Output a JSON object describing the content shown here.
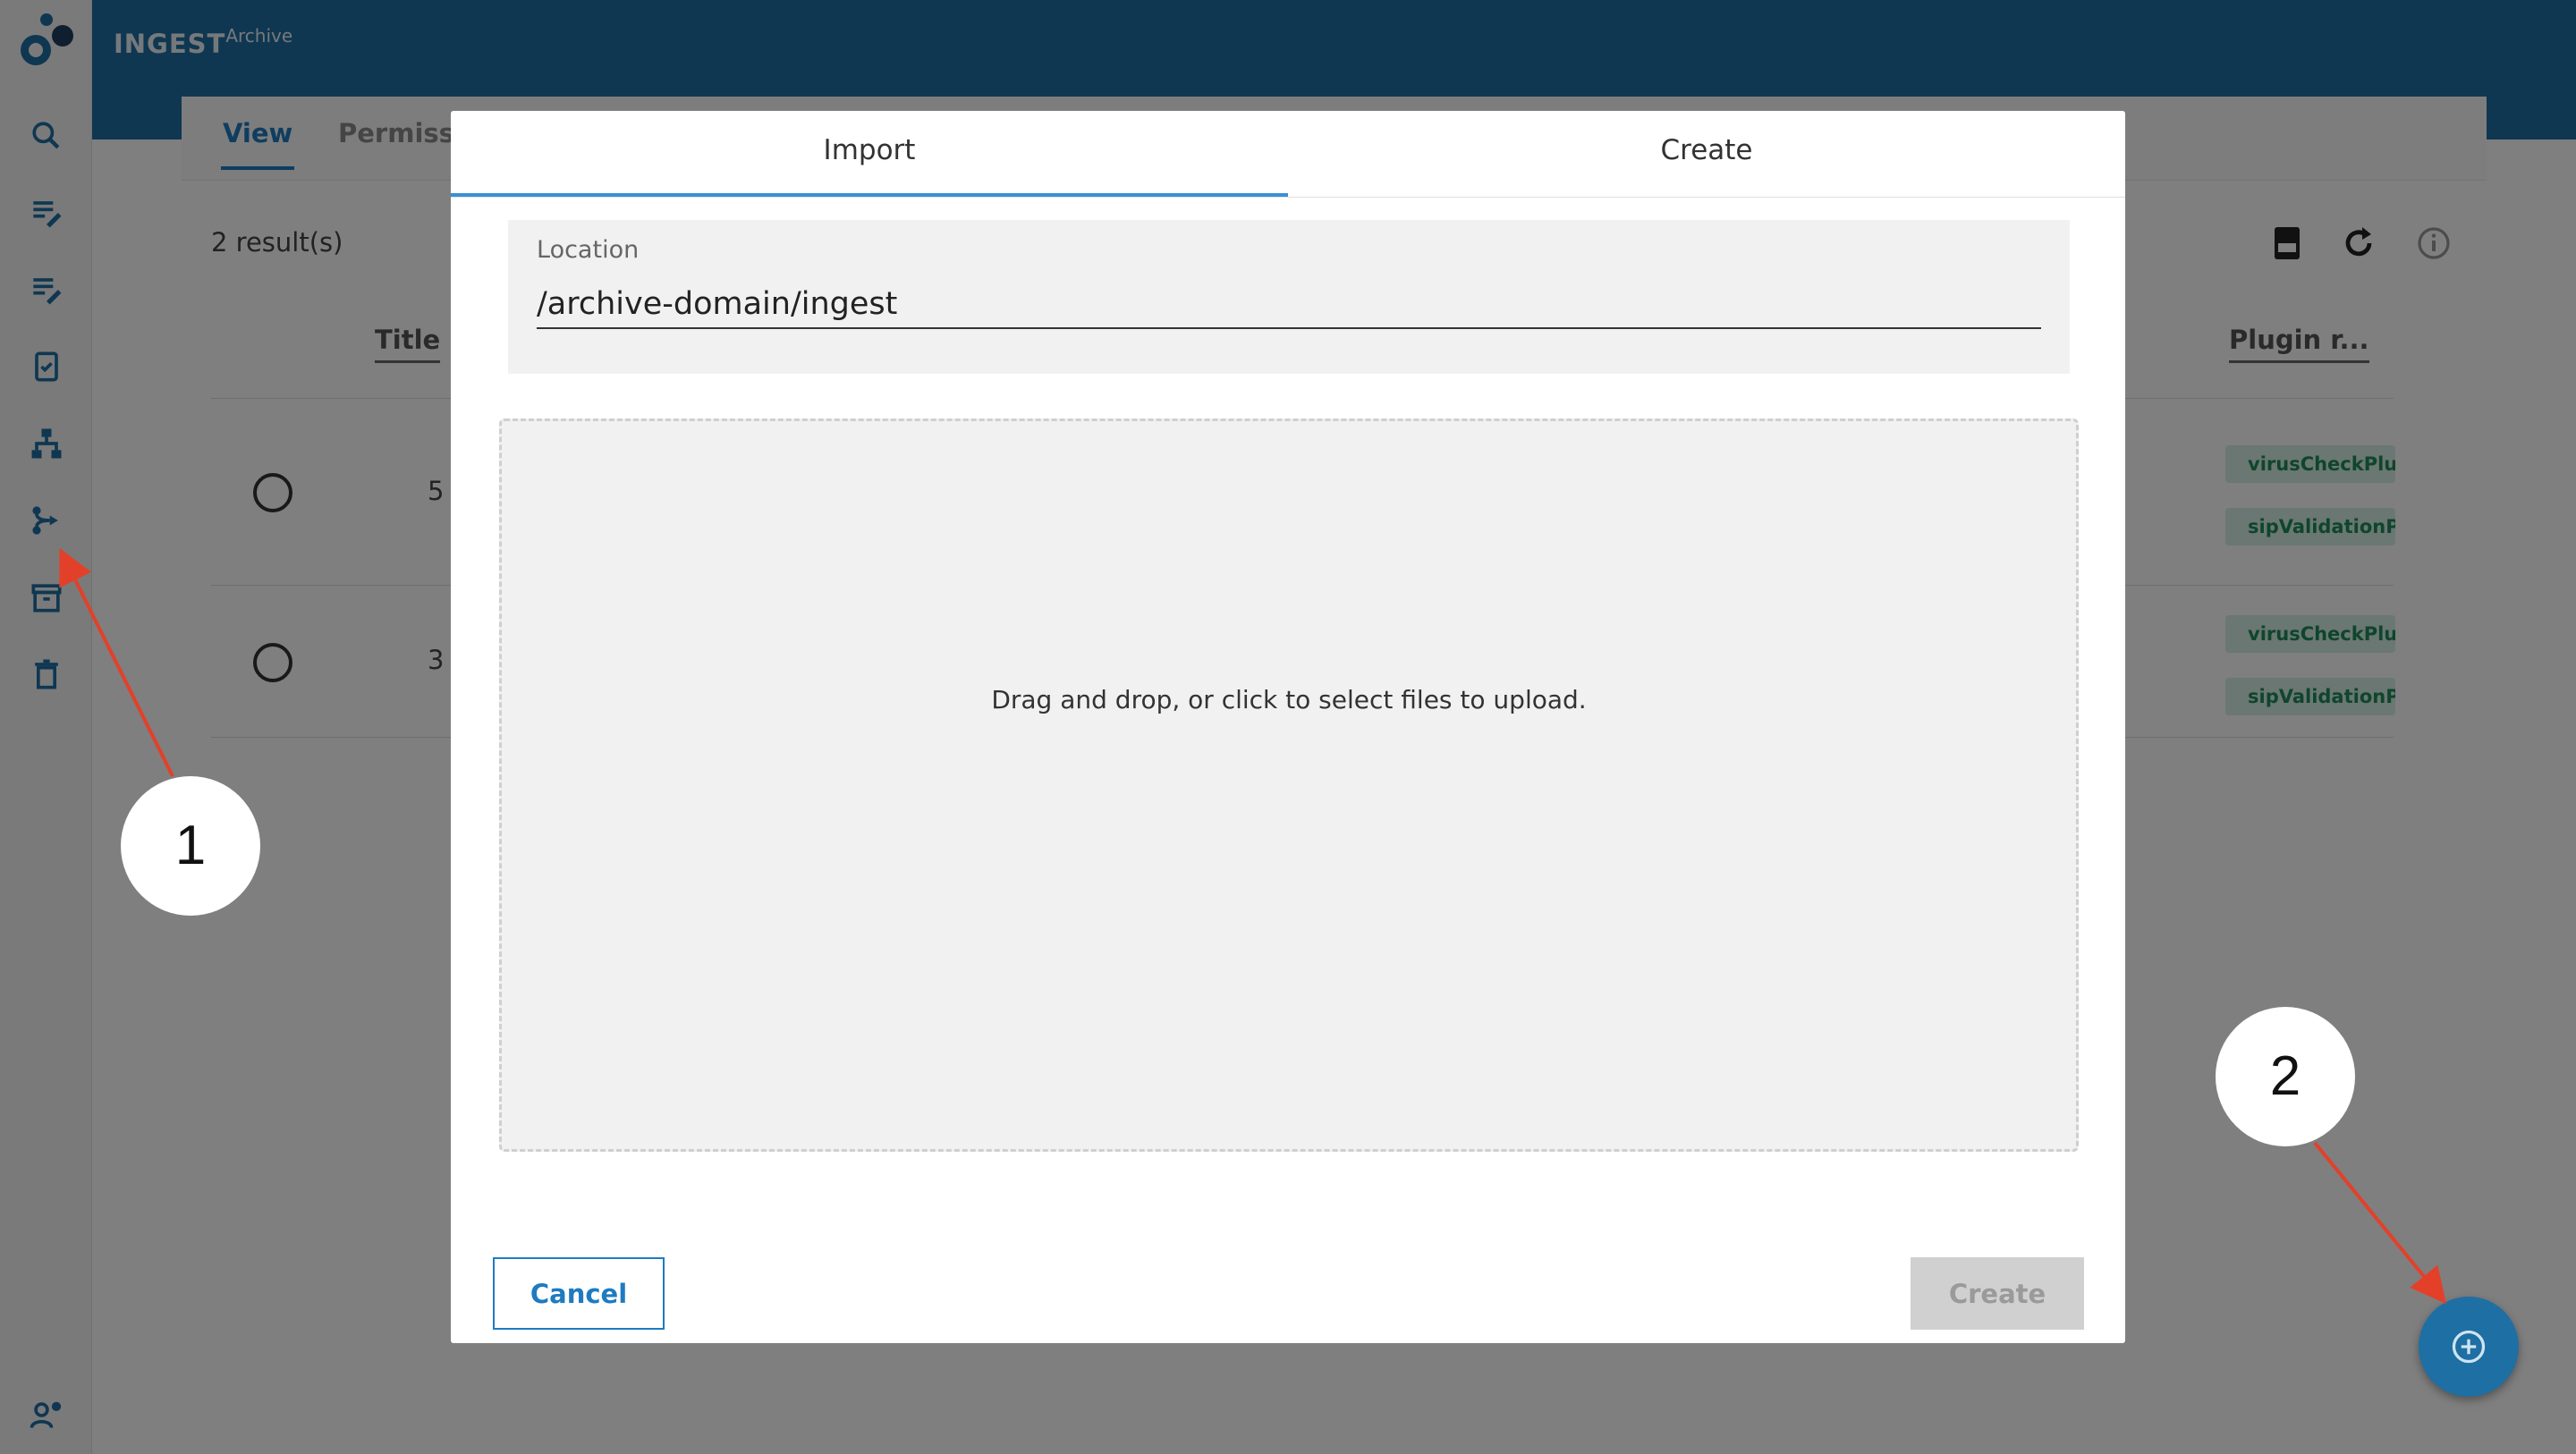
{
  "app": {
    "brand_main": "INGEST",
    "brand_sub": "Archive",
    "accent": "#1e6fa3"
  },
  "sidebar": {
    "icons": [
      "logo-icon",
      "search-icon",
      "edit-list-icon",
      "edit-list-icon",
      "checklist-icon",
      "hierarchy-icon",
      "workflow-icon",
      "archive-box-icon",
      "trash-icon",
      "user-settings-icon"
    ]
  },
  "page": {
    "tabs": [
      {
        "label": "View"
      },
      {
        "label": "Permissi"
      }
    ],
    "result_count": "2 result(s)",
    "columns": {
      "title": "Title",
      "plugin": "Plugin r..."
    },
    "rows": [
      {
        "cell": "5",
        "tags": [
          "virusCheckPlug",
          "sipValidationP"
        ]
      },
      {
        "cell": "3",
        "tags": [
          "virusCheckPlug",
          "sipValidationP"
        ]
      }
    ]
  },
  "modal": {
    "tabs": [
      {
        "label": "Import"
      },
      {
        "label": "Create"
      }
    ],
    "location_label": "Location",
    "location_value": "/archive-domain/ingest",
    "dropzone_text": "Drag and drop, or click to select files to upload.",
    "cancel_label": "Cancel",
    "create_label": "Create"
  },
  "annotations": [
    {
      "label": "1"
    },
    {
      "label": "2"
    }
  ]
}
